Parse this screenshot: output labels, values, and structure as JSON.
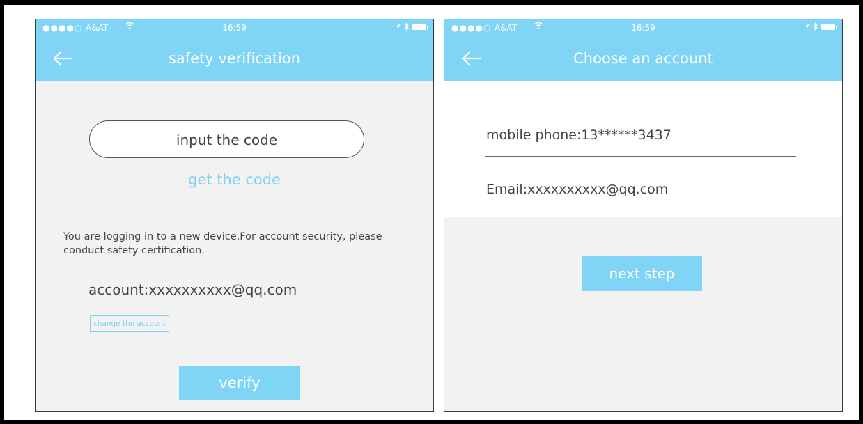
{
  "status_bar": {
    "carrier": "A&AT",
    "time": "16:59"
  },
  "screen_left": {
    "title": "safety verification",
    "code_input_placeholder": "input the code",
    "get_code_link": "get the code",
    "notice": "You are logging in to a new device.For account security, please conduct safety certification.",
    "account_label": "account:xxxxxxxxxx@qq.com",
    "change_account_label": "change the account",
    "verify_button": "verify"
  },
  "screen_right": {
    "title": "Choose an account",
    "accounts": [
      {
        "label": "mobile phone:13******3437"
      },
      {
        "label": "Email:xxxxxxxxxx@qq.com"
      }
    ],
    "next_button": "next step"
  },
  "colors": {
    "accent": "#80d4f6",
    "link": "#7dd1f3",
    "background": "#f2f2f2",
    "text": "#444444"
  },
  "icons": {
    "back": "arrow-left-icon",
    "wifi": "wifi-icon",
    "location": "location-arrow-icon",
    "bluetooth": "bluetooth-icon",
    "battery": "battery-icon"
  }
}
